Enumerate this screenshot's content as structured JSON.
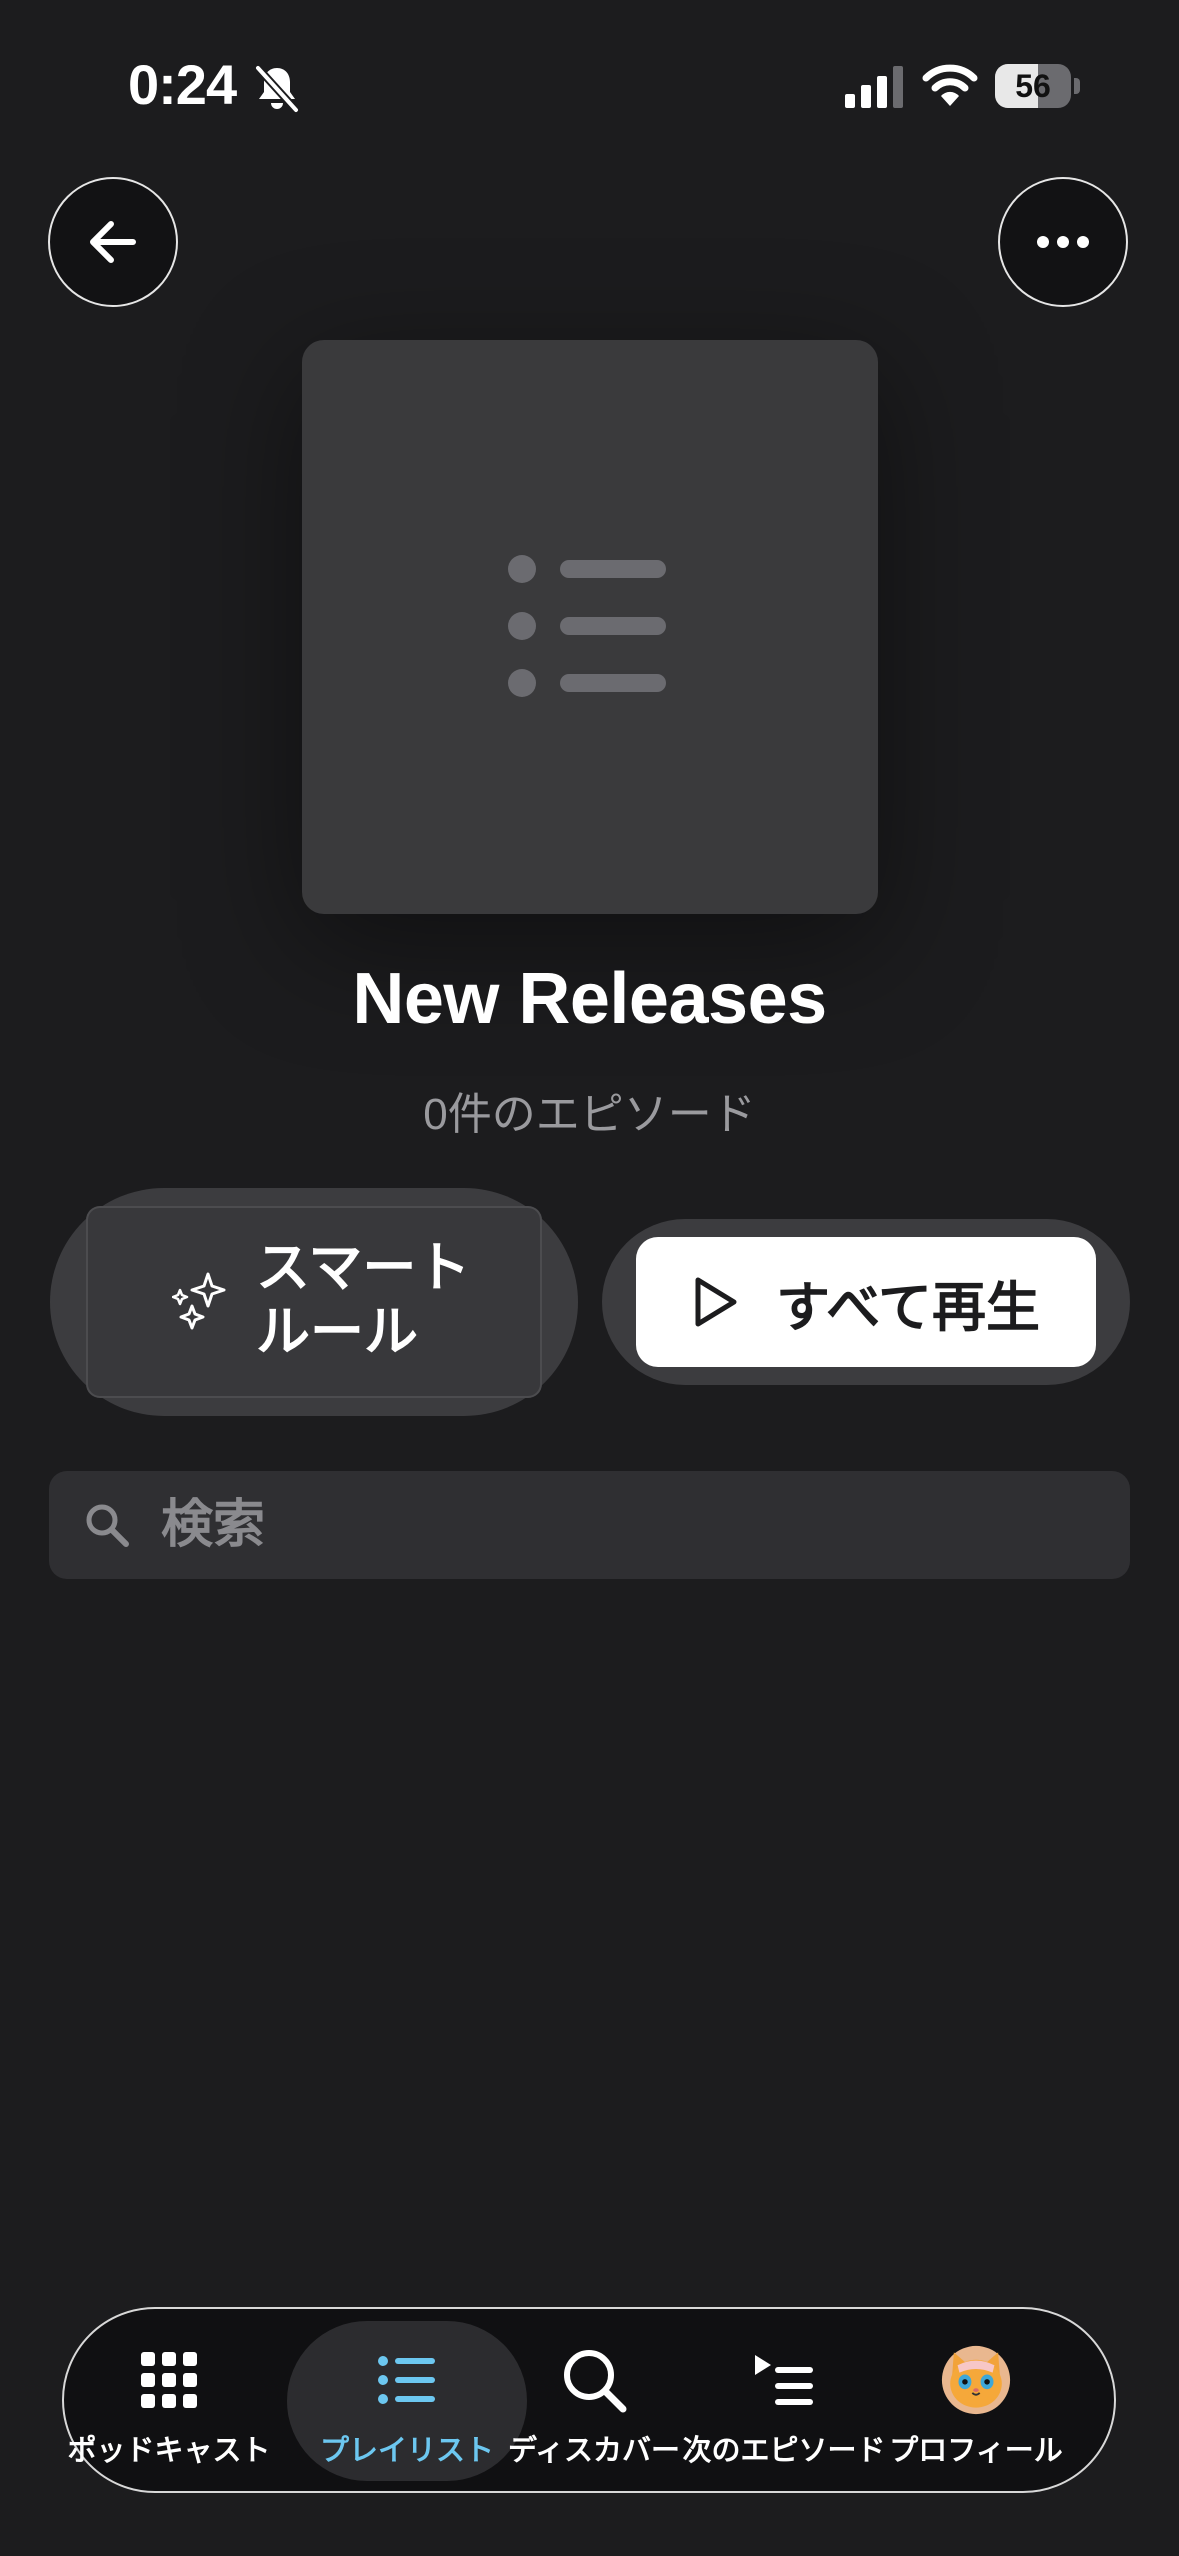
{
  "status_bar": {
    "time": "0:24",
    "battery": "56",
    "battery_level": 0.56,
    "bell": "bell-slash-icon",
    "signal": "cellular-signal-icon",
    "wifi": "wifi-icon"
  },
  "header": {
    "back_icon": "arrow-left-icon",
    "more_icon": "ellipsis-icon"
  },
  "playlist": {
    "artwork_icon": "list-icon",
    "title": "New Releases",
    "episode_count": "0件のエピソード"
  },
  "actions": {
    "smart_rules_icon": "sparkles-icon",
    "smart_rules_label": "スマート\nルール",
    "play_all_icon": "play-icon",
    "play_all_label": "すべて再生"
  },
  "search": {
    "icon": "magnifying-glass-icon",
    "placeholder": "検索"
  },
  "tab_bar": {
    "active_tab": "プレイリスト",
    "active_color": "#6cc7f0",
    "tabs": [
      {
        "label": "ポッドキャスト",
        "icon": "grid-icon"
      },
      {
        "label": "プレイリスト",
        "icon": "list-icon"
      },
      {
        "label": "ディスカバー",
        "icon": "search-icon"
      },
      {
        "label": "次のエピソード",
        "icon": "up-next-icon"
      },
      {
        "label": "プロフィール",
        "icon": "avatar-cat-icon"
      }
    ]
  }
}
